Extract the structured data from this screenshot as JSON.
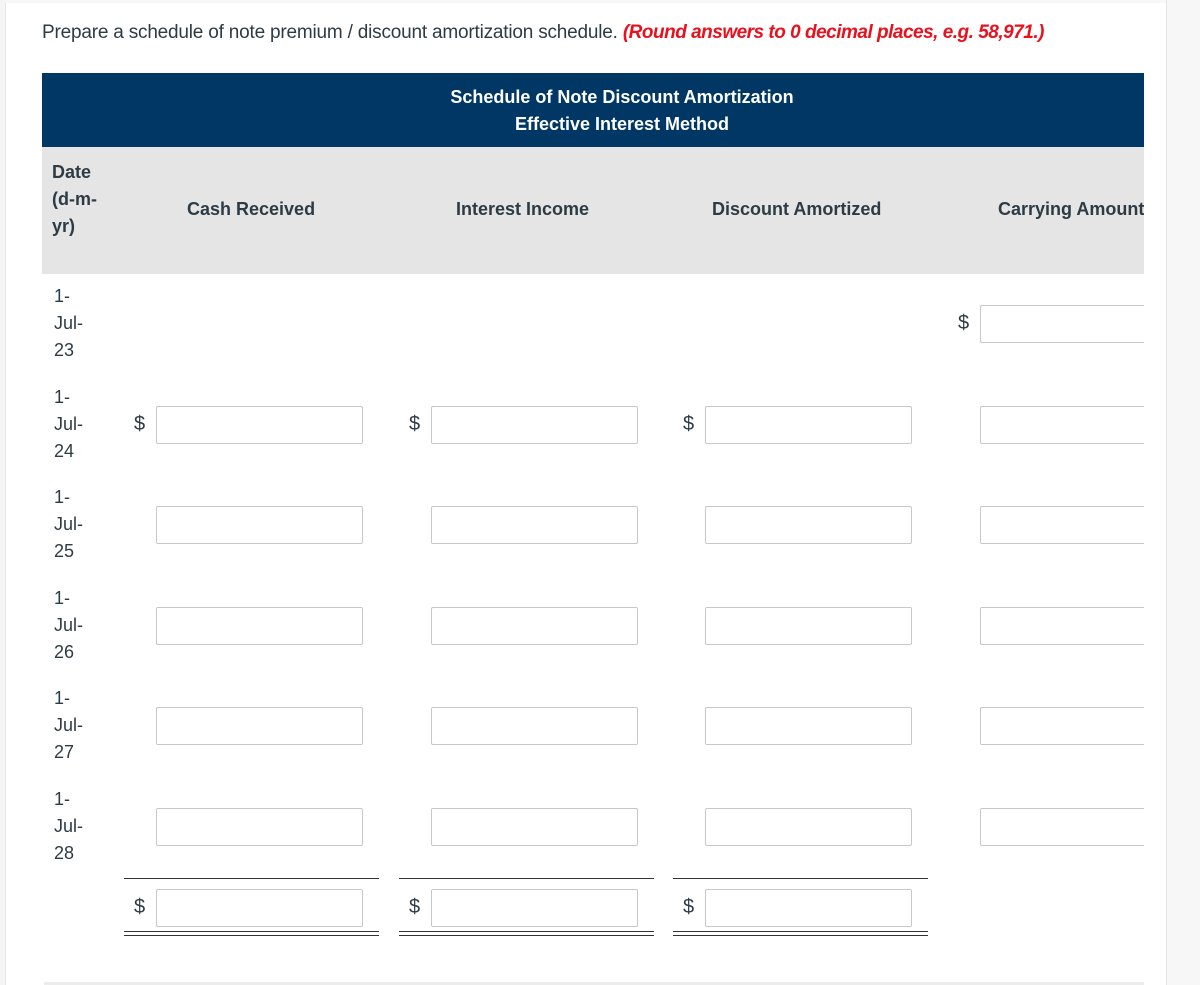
{
  "prompt": {
    "instruction": "Prepare a schedule of note premium / discount amortization schedule.",
    "hint": "(Round answers to 0 decimal places, e.g. 58,971.)"
  },
  "table": {
    "title_line1": "Schedule of Note Discount Amortization",
    "title_line2": "Effective Interest Method",
    "headers": {
      "date": "Date (d-m-yr)",
      "cash_received": "Cash Received",
      "interest_income": "Interest Income",
      "discount_amortized": "Discount Amortized",
      "carrying_amount": "Carrying Amount"
    },
    "currency_symbol": "$",
    "rows": [
      {
        "date": "1-Jul-23",
        "cash_received": "",
        "interest_income": "",
        "discount_amortized": "",
        "carrying_amount": ""
      },
      {
        "date": "1-Jul-24",
        "cash_received": "",
        "interest_income": "",
        "discount_amortized": "",
        "carrying_amount": ""
      },
      {
        "date": "1-Jul-25",
        "cash_received": "",
        "interest_income": "",
        "discount_amortized": "",
        "carrying_amount": ""
      },
      {
        "date": "1-Jul-26",
        "cash_received": "",
        "interest_income": "",
        "discount_amortized": "",
        "carrying_amount": ""
      },
      {
        "date": "1-Jul-27",
        "cash_received": "",
        "interest_income": "",
        "discount_amortized": "",
        "carrying_amount": ""
      },
      {
        "date": "1-Jul-28",
        "cash_received": "",
        "interest_income": "",
        "discount_amortized": "",
        "carrying_amount": ""
      }
    ],
    "totals": {
      "cash_received": "",
      "interest_income": "",
      "discount_amortized": ""
    }
  },
  "colors": {
    "banner": "#003764",
    "header_bg": "#e5e5e5",
    "hint": "#e8111d",
    "text": "#2d3b45"
  }
}
